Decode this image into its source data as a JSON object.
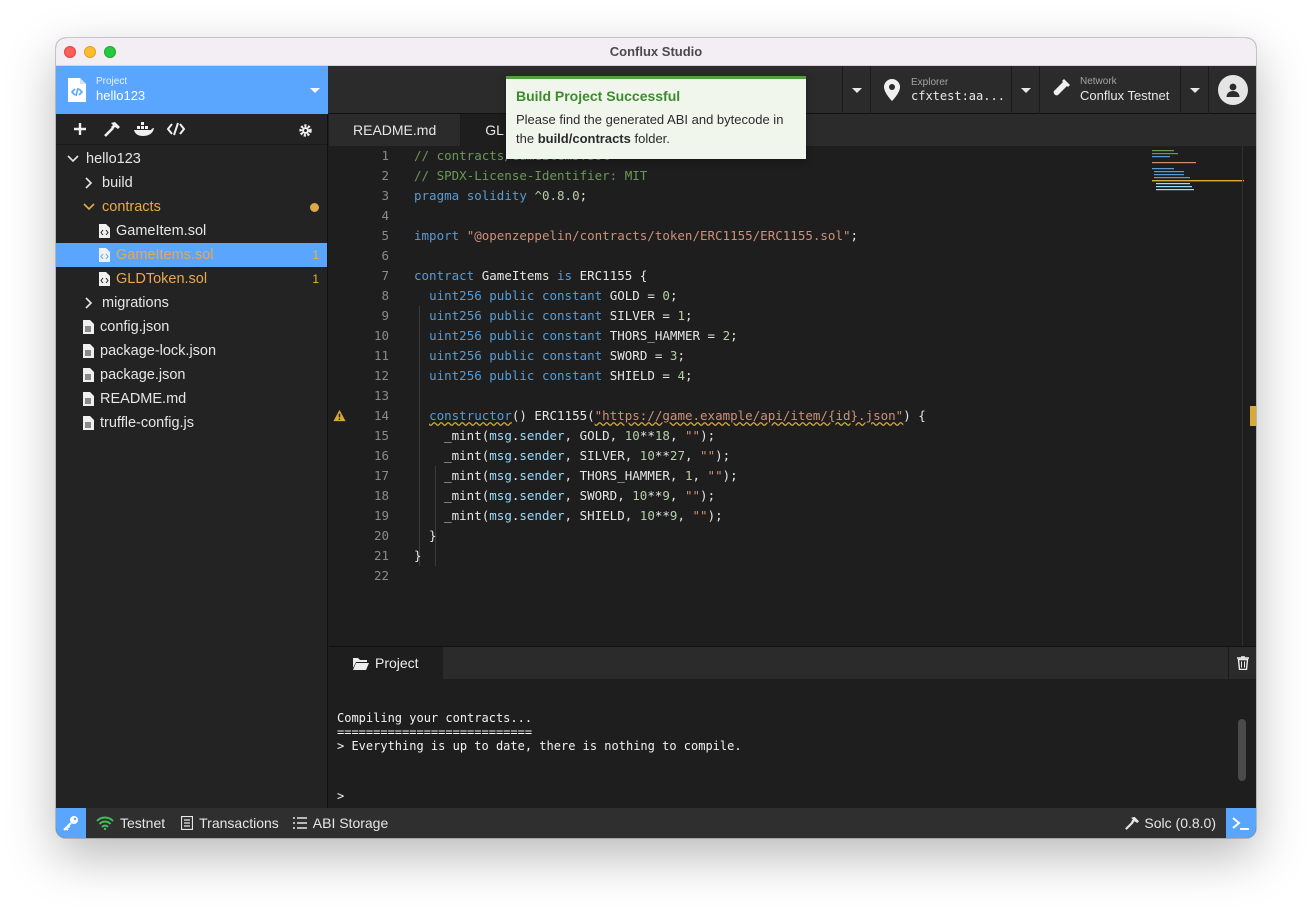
{
  "window": {
    "title": "Conflux Studio"
  },
  "header": {
    "project": {
      "label": "Project",
      "value": "hello123"
    },
    "explorer": {
      "label": "Explorer",
      "value": "cfxtest:aa..."
    },
    "network": {
      "label": "Network",
      "value": "Conflux Testnet"
    }
  },
  "tree": {
    "root": "hello123",
    "build": "build",
    "contracts": "contracts",
    "gameitem": "GameItem.sol",
    "gameitems": "GameItems.sol",
    "gameitems_badge": "1",
    "gldtoken": "GLDToken.sol",
    "gldtoken_badge": "1",
    "migrations": "migrations",
    "config": "config.json",
    "packagelock": "package-lock.json",
    "package": "package.json",
    "readme": "README.md",
    "truffle": "truffle-config.js"
  },
  "tabs": [
    "README.md",
    "GL"
  ],
  "editor": {
    "line_numbers": [
      "1",
      "2",
      "3",
      "4",
      "5",
      "6",
      "7",
      "8",
      "9",
      "10",
      "11",
      "12",
      "13",
      "14",
      "15",
      "16",
      "17",
      "18",
      "19",
      "20",
      "21",
      "22"
    ]
  },
  "toast": {
    "title": "Build Project Successful",
    "message_pre": "Please find the generated ABI and bytecode in the ",
    "message_bold": "build/contracts",
    "message_post": " folder."
  },
  "terminal": {
    "tab": "Project",
    "line1": "Compiling your contracts...",
    "line2": "===========================",
    "line3": "> Everything is up to date, there is nothing to compile.",
    "prompt": ">"
  },
  "statusbar": {
    "network": "Testnet",
    "transactions": "Transactions",
    "abi": "ABI Storage",
    "solc": "Solc (0.8.0)"
  },
  "colors": {
    "accent": "#5aa6ff",
    "success": "#4fa23a",
    "warning": "#d7a93a",
    "modified": "#e8a94a"
  }
}
